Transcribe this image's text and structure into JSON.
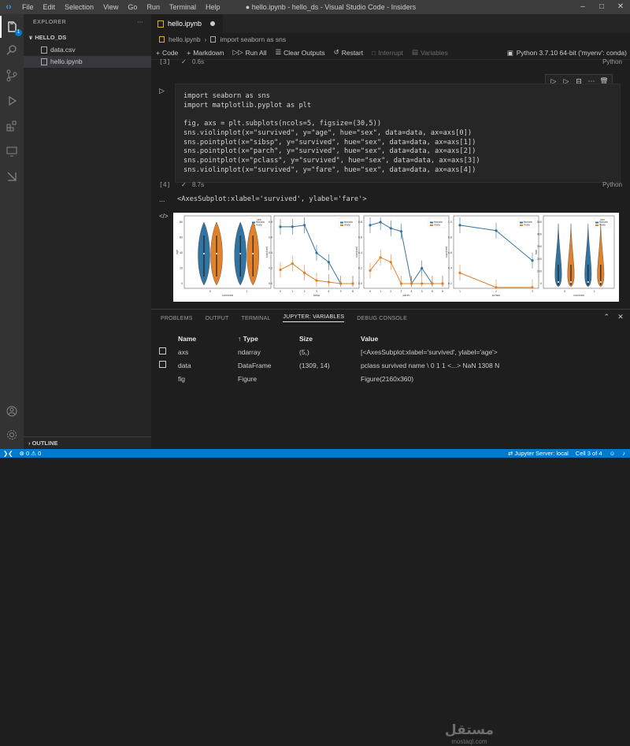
{
  "titlebar": {
    "menu": [
      "File",
      "Edit",
      "Selection",
      "View",
      "Go",
      "Run",
      "Terminal",
      "Help"
    ],
    "window_title": "● hello.ipynb - hello_ds - Visual Studio Code - Insiders"
  },
  "activity": {
    "badge": "1"
  },
  "sidebar": {
    "header": "EXPLORER",
    "folder": "HELLO_DS",
    "files": [
      "data.csv",
      "hello.ipynb"
    ],
    "outline": "OUTLINE"
  },
  "editor": {
    "tab": "hello.ipynb",
    "breadcrumb": [
      "hello.ipynb",
      "import seaborn as sns"
    ],
    "toolbar": {
      "code": "Code",
      "markdown": "Markdown",
      "run_all": "Run All",
      "clear": "Clear Outputs",
      "restart": "Restart",
      "interrupt": "Interrupt",
      "variables": "Variables"
    },
    "kernel": "Python 3.7.10 64-bit ('myenv': conda)",
    "prev_cell": {
      "num": "[3]",
      "time": "0.6s",
      "lang": "Python"
    },
    "code_lines": [
      "import seaborn as sns",
      "import matplotlib.pyplot as plt",
      "",
      "fig, axs = plt.subplots(ncols=5, figsize=(30,5))",
      "sns.violinplot(x=\"survived\", y=\"age\", hue=\"sex\", data=data, ax=axs[0])",
      "sns.pointplot(x=\"sibsp\", y=\"survived\", hue=\"sex\", data=data, ax=axs[1])",
      "sns.pointplot(x=\"parch\", y=\"survived\", hue=\"sex\", data=data, ax=axs[2])",
      "sns.pointplot(x=\"pclass\", y=\"survived\", hue=\"sex\", data=data, ax=axs[3])",
      "sns.violinplot(x=\"survived\", y=\"fare\", hue=\"sex\", data=data, ax=axs[4])"
    ],
    "cell": {
      "num": "[4]",
      "time": "8.7s",
      "lang": "Python"
    },
    "output_text": "<AxesSubplot:xlabel='survived', ylabel='fare'>",
    "output_more": "...",
    "output_icon": "</>"
  },
  "chart_data": [
    {
      "type": "violin",
      "xlabel": "survived",
      "ylabel": "age",
      "categories": [
        "0",
        "1"
      ],
      "legend": [
        "female",
        "male"
      ],
      "legend_title": "sex",
      "yticks": [
        "0",
        "20",
        "40",
        "60",
        "80"
      ]
    },
    {
      "type": "line",
      "xlabel": "sibsp",
      "ylabel": "survived",
      "x": [
        0,
        1,
        2,
        3,
        4,
        5,
        8
      ],
      "series": [
        {
          "name": "female",
          "values": [
            0.74,
            0.74,
            0.76,
            0.4,
            0.28,
            0.0,
            0.0
          ]
        },
        {
          "name": "male",
          "values": [
            0.18,
            0.26,
            0.14,
            0.04,
            0.02,
            0.0,
            0.0
          ]
        }
      ],
      "yticks": [
        "0.0",
        "0.2",
        "0.4",
        "0.6",
        "0.8"
      ]
    },
    {
      "type": "line",
      "xlabel": "parch",
      "ylabel": "survived",
      "x": [
        0,
        1,
        2,
        3,
        4,
        5,
        6,
        9
      ],
      "series": [
        {
          "name": "female",
          "values": [
            0.76,
            0.8,
            0.72,
            0.68,
            0.0,
            0.2,
            0.0,
            0.0
          ]
        },
        {
          "name": "male",
          "values": [
            0.17,
            0.34,
            0.28,
            0.0,
            0.0,
            0.0,
            0.0,
            0.0
          ]
        }
      ],
      "yticks": [
        "0.0",
        "0.2",
        "0.4",
        "0.6",
        "0.8"
      ]
    },
    {
      "type": "line",
      "xlabel": "pclass",
      "ylabel": "survived",
      "x": [
        1,
        2,
        3
      ],
      "series": [
        {
          "name": "female",
          "values": [
            0.96,
            0.89,
            0.5
          ]
        },
        {
          "name": "male",
          "values": [
            0.34,
            0.15,
            0.15
          ]
        }
      ],
      "yticks": [
        "0.2",
        "0.4",
        "0.6",
        "0.8",
        "1.0"
      ]
    },
    {
      "type": "violin",
      "xlabel": "survived",
      "ylabel": "fare",
      "categories": [
        "0",
        "1"
      ],
      "legend": [
        "female",
        "male"
      ],
      "legend_title": "sex",
      "yticks": [
        "0",
        "100",
        "200",
        "300",
        "400",
        "500"
      ]
    }
  ],
  "panel": {
    "tabs": [
      "PROBLEMS",
      "OUTPUT",
      "TERMINAL",
      "JUPYTER: VARIABLES",
      "DEBUG CONSOLE"
    ],
    "columns": [
      "Name",
      "Type",
      "Size",
      "Value"
    ],
    "rows": [
      {
        "name": "axs",
        "type": "ndarray",
        "size": "(5,)",
        "value": "[<AxesSubplot:xlabel='survived', ylabel='age'>"
      },
      {
        "name": "data",
        "type": "DataFrame",
        "size": "(1309, 14)",
        "value": "pclass survived name \\ 0 1 1 <...> NaN 1308 N"
      },
      {
        "name": "fig",
        "type": "Figure",
        "size": "",
        "value": "Figure(2160x360)"
      }
    ]
  },
  "statusbar": {
    "errors": "0",
    "warnings": "0",
    "jupyter": "Jupyter Server: local",
    "cell": "Cell 3 of 4"
  },
  "watermark": {
    "main": "مستقل",
    "sub": "mostaql.com"
  }
}
